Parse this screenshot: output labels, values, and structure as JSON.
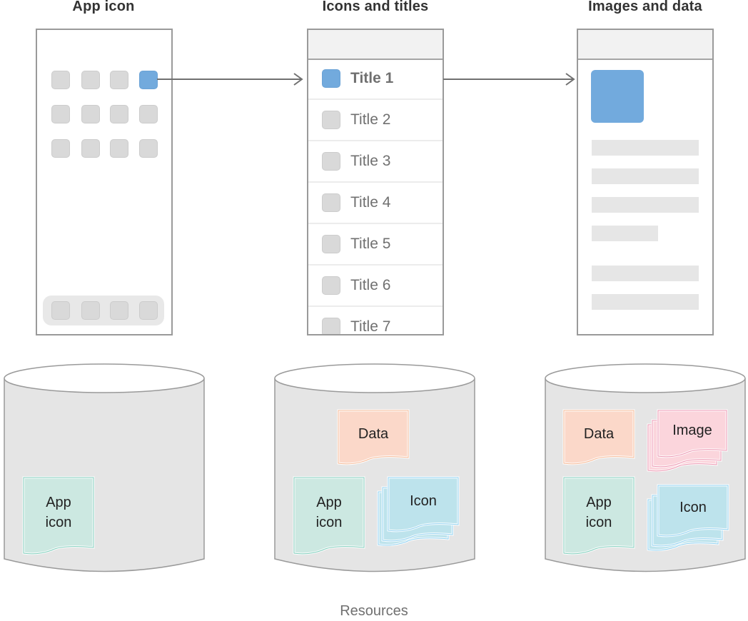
{
  "columns": [
    {
      "title": "App icon"
    },
    {
      "title": "Icons and titles"
    },
    {
      "title": "Images and data"
    }
  ],
  "list_rows": [
    {
      "label": "Title 1",
      "selected": true
    },
    {
      "label": "Title 2",
      "selected": false
    },
    {
      "label": "Title 3",
      "selected": false
    },
    {
      "label": "Title 4",
      "selected": false
    },
    {
      "label": "Title 5",
      "selected": false
    },
    {
      "label": "Title 6",
      "selected": false
    },
    {
      "label": "Title 7",
      "selected": false
    }
  ],
  "resources": {
    "app_icon": {
      "line1": "App",
      "line2": "icon"
    },
    "data": "Data",
    "icon": "Icon",
    "image": "Image"
  },
  "colors": {
    "accent_blue": "#72aadd",
    "app_icon_fill": "#cce8e1",
    "app_icon_stroke": "#7fcdbb",
    "data_fill": "#fbd8c9",
    "data_stroke": "#f5b894",
    "icon_fill": "#bde3ec",
    "icon_stroke": "#8fd0f0",
    "image_fill": "#fbd5dc",
    "image_stroke": "#ec95b0"
  },
  "footer": "Resources"
}
